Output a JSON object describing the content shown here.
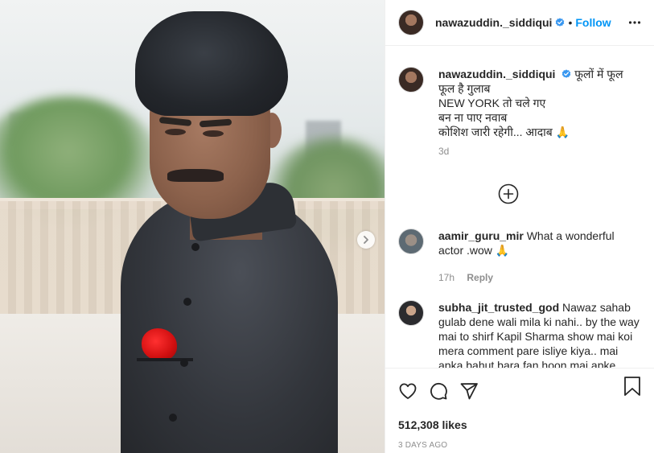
{
  "post": {
    "author": "nawazuddin._siddiqui",
    "follow_label": "Follow",
    "separator": "•"
  },
  "caption": {
    "username": "nawazuddin._siddiqui",
    "lines": [
      "फूलों में फूल",
      "फूल है गुलाब",
      "NEW YORK तो चले गए",
      "बन ना पाए नवाब",
      "कोशिश जारी रहेगी... आदाब 🙏"
    ],
    "time": "3d"
  },
  "comments": [
    {
      "username": "aamir_guru_mir",
      "text": "What a wonderful actor .wow 🙏",
      "time": "17h",
      "reply_label": "Reply"
    },
    {
      "username": "subha_jit_trusted_god",
      "text": "Nawaz sahab gulab dene wali mila ki nahi.. by the way mai to shirf Kapil Sharma show mai koi mera comment pare isliye kiya.. mai apka bahut bara fan hoon mai apke tarha banna chahta hoon",
      "time": "",
      "reply_label": ""
    }
  ],
  "engagement": {
    "likes": "512,308 likes",
    "date": "3 DAYS AGO"
  },
  "icons": {
    "verified": "verified-badge-icon",
    "more": "more-options-icon",
    "load_more": "plus-circle-icon",
    "like": "heart-icon",
    "comment": "comment-bubble-icon",
    "share": "paper-plane-icon",
    "save": "bookmark-icon",
    "next": "chevron-right-icon"
  },
  "colors": {
    "accent": "#0095f6",
    "verified": "#3897f0",
    "muted": "#8e8e8e",
    "text": "#262626"
  }
}
